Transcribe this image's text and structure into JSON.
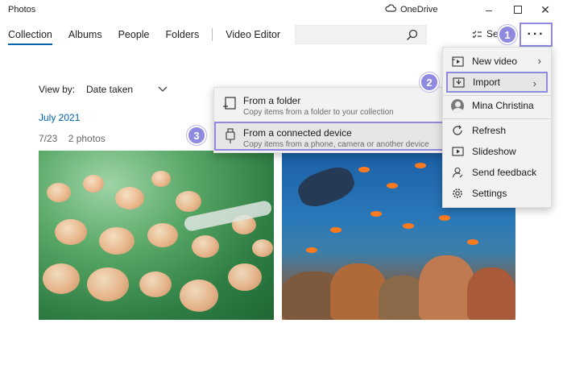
{
  "window": {
    "title": "Photos",
    "onedrive_label": "OneDrive"
  },
  "nav": {
    "tabs": [
      {
        "label": "Collection",
        "active": true
      },
      {
        "label": "Albums",
        "active": false
      },
      {
        "label": "People",
        "active": false
      },
      {
        "label": "Folders",
        "active": false
      },
      {
        "label": "Video Editor",
        "active": false
      }
    ]
  },
  "toolbar": {
    "select_label": "Se",
    "more_label": "···"
  },
  "view": {
    "view_by_label": "View by:",
    "view_by_value": "Date taken"
  },
  "gallery": {
    "month": "July 2021",
    "date": "7/23",
    "count": "2 photos"
  },
  "menu": {
    "items": [
      {
        "label": "New video",
        "icon": "video-icon",
        "has_submenu": true
      },
      {
        "label": "Import",
        "icon": "import-icon",
        "has_submenu": true
      },
      {
        "label": "Mina Christina",
        "icon": "avatar"
      },
      {
        "label": "Refresh",
        "icon": "refresh-icon"
      },
      {
        "label": "Slideshow",
        "icon": "slideshow-icon"
      },
      {
        "label": "Send feedback",
        "icon": "feedback-icon"
      },
      {
        "label": "Settings",
        "icon": "gear-icon"
      }
    ]
  },
  "import_submenu": {
    "items": [
      {
        "title": "From a folder",
        "desc": "Copy items from a folder to your collection",
        "icon": "folder-import-icon"
      },
      {
        "title": "From a connected device",
        "desc": "Copy items from a phone, camera or another device",
        "icon": "usb-icon"
      }
    ]
  },
  "badges": [
    "1",
    "2",
    "3"
  ],
  "colors": {
    "accent": "#0063b1",
    "highlight": "#8f8ae0",
    "menu_bg": "#f2f2f2"
  }
}
